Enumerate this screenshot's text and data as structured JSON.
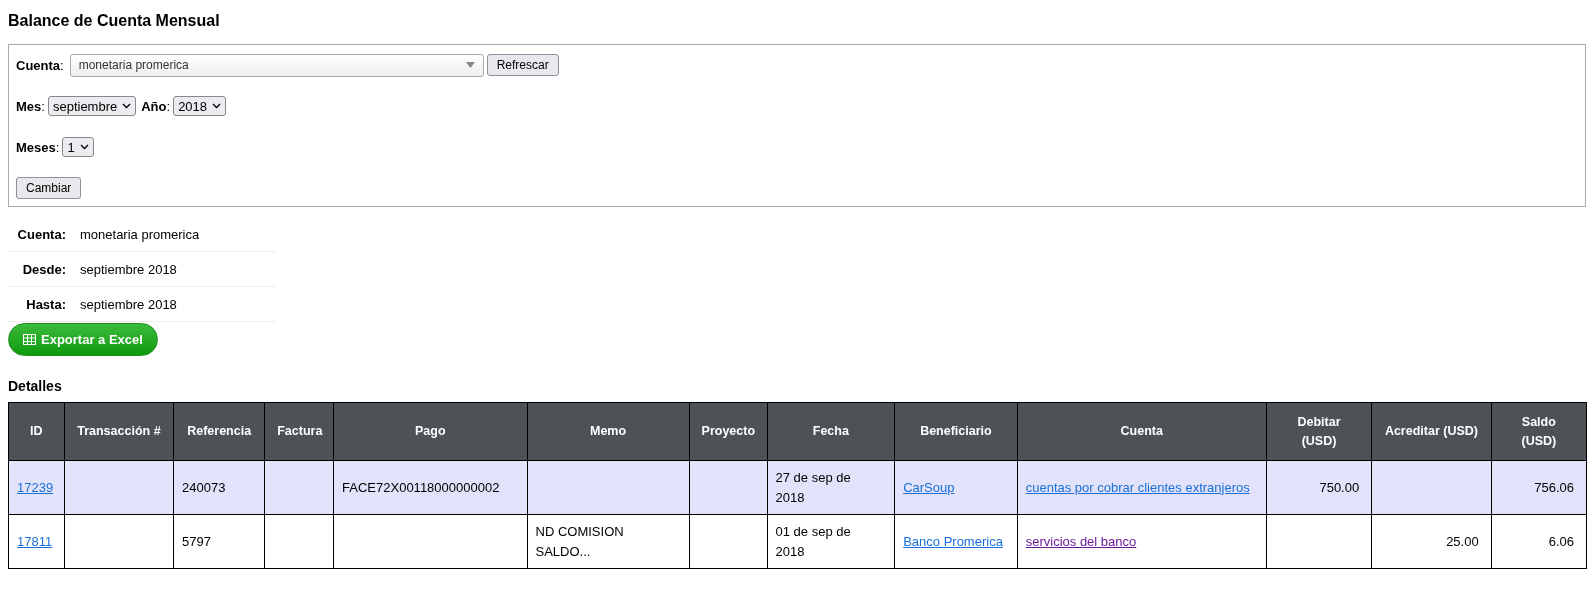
{
  "title": "Balance de Cuenta Mensual",
  "filters": {
    "account_label": "**Cuenta**:",
    "account_value": "monetaria promerica",
    "refresh_button": "Refrescar",
    "month_label": "**Mes**:",
    "month_value": "septiembre",
    "year_label": "**Año**:",
    "year_value": "2018",
    "months_label": "**Meses**:",
    "months_value": "1",
    "change_button": "Cambiar"
  },
  "summary": [
    {
      "label": "Cuenta:",
      "value": "monetaria promerica"
    },
    {
      "label": "Desde:",
      "value": "septiembre 2018"
    },
    {
      "label": "Hasta:",
      "value": "septiembre 2018"
    }
  ],
  "export_button": "Exportar a Excel",
  "details_title": "Detalles",
  "table": {
    "columns": [
      "ID",
      "Transacción #",
      "Referencia",
      "Factura",
      "Pago",
      "Memo",
      "Proyecto",
      "Fecha",
      "Beneficiario",
      "Cuenta",
      "Debitar (USD)",
      "Acreditar (USD)",
      "Saldo (USD)"
    ],
    "rows": [
      {
        "highlighted": true,
        "id": "17239",
        "transaction": "",
        "reference": "240073",
        "invoice": "",
        "payment": "FACE72X00118000000002",
        "memo": "",
        "project": "",
        "date": "27 de sep de 2018",
        "payee": "CarSoup",
        "account": "cuentas por cobrar clientes extranjeros",
        "account_visited": false,
        "debit": "750.00",
        "credit": "",
        "balance": "756.06"
      },
      {
        "highlighted": false,
        "id": "17811",
        "transaction": "",
        "reference": "5797",
        "invoice": "",
        "payment": "",
        "memo": "ND COMISION SALDO...",
        "project": "",
        "date": "01 de sep de 2018",
        "payee": "Banco Promerica",
        "account": "servicios del banco",
        "account_visited": true,
        "debit": "",
        "credit": "25.00",
        "balance": "6.06"
      }
    ]
  }
}
